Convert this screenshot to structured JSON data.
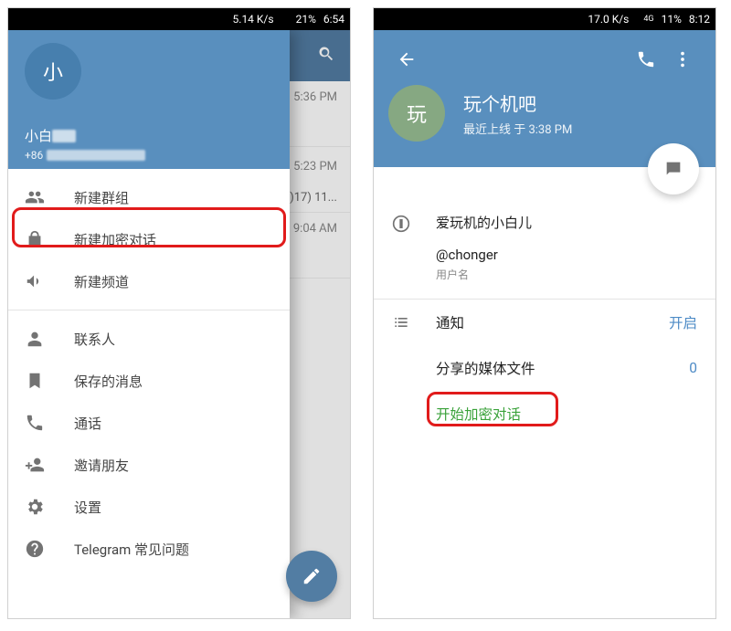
{
  "phone1": {
    "statusbar": {
      "speed": "5.14 K/s",
      "battery": "21%",
      "time": "6:54"
    },
    "drawer": {
      "avatar_letter": "小",
      "display_name": "小白",
      "phone_prefix": "+86",
      "menu": {
        "new_group": "新建群组",
        "new_secret_chat": "新建加密对话",
        "new_channel": "新建频道",
        "contacts": "联系人",
        "saved_messages": "保存的消息",
        "calls": "通话",
        "invite_friends": "邀请朋友",
        "settings": "设置",
        "faq": "Telegram 常见问题"
      }
    },
    "chat_peek": {
      "t1": "5:36 PM",
      "t2": "5:23 PM",
      "t2_sub": ")17) 11...",
      "t3": "9:04 AM"
    }
  },
  "phone2": {
    "statusbar": {
      "speed": "17.0 K/s",
      "net": "4G",
      "battery": "11%",
      "time": "8:12"
    },
    "profile": {
      "avatar_letter": "玩",
      "title": "玩个机吧",
      "last_seen": "最近上线 于 3:38 PM",
      "bio": "爱玩机的小白儿",
      "handle": "@chonger",
      "handle_caption": "用户名",
      "notifications_label": "通知",
      "notifications_value": "开启",
      "shared_media_label": "分享的媒体文件",
      "shared_media_value": "0",
      "start_secret_chat": "开始加密对话"
    }
  }
}
